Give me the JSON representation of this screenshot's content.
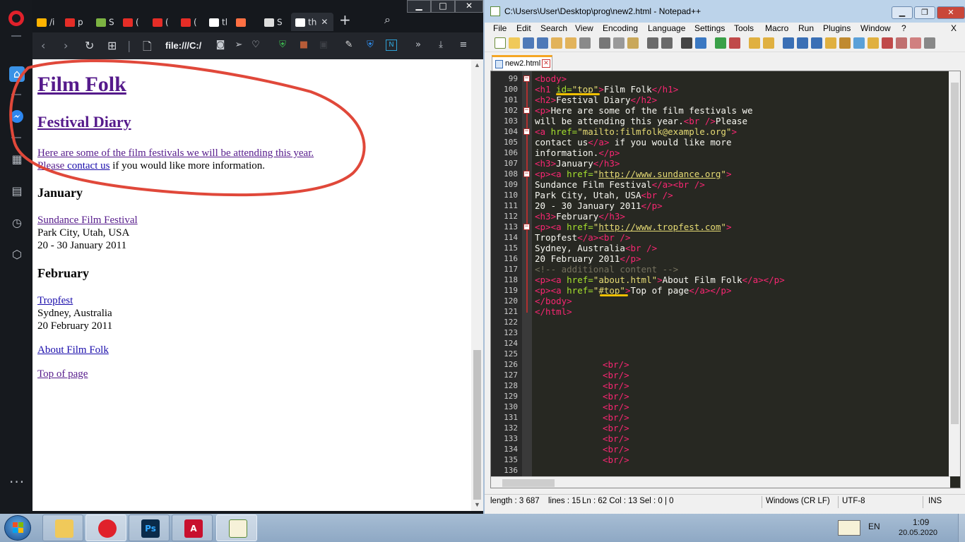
{
  "browser": {
    "tabs": [
      {
        "label": "/i",
        "fav_color": "#ffb300"
      },
      {
        "label": "p",
        "fav_color": "#e52d27"
      },
      {
        "label": "S",
        "fav_color": "#7cb342"
      },
      {
        "label": "(",
        "fav_color": "#e52d27"
      },
      {
        "label": "(",
        "fav_color": "#e52d27"
      },
      {
        "label": "(",
        "fav_color": "#e52d27"
      },
      {
        "label": "tl",
        "fav_color": "#ffffff"
      },
      {
        "label": "",
        "fav_color": "#ff7043"
      },
      {
        "label": "S",
        "fav_color": "#dddddd"
      },
      {
        "label": "th",
        "fav_color": "#ffffff"
      }
    ],
    "address": "file:///C:/",
    "accent": "#e0212b"
  },
  "page": {
    "h1": "Film Folk",
    "h2": "Festival Diary",
    "intro_line1": "Here are some of the film festivals we will be attending this year.",
    "intro_line2_prefix": "Please ",
    "intro_link": "contact us",
    "intro_line2_suffix": " if you would like more information.",
    "jan_heading": "January",
    "jan_link": "Sundance Film Festival",
    "jan_place": "Park City, Utah, USA",
    "jan_dates": "20 - 30 January 2011",
    "feb_heading": "February",
    "feb_link": "Tropfest",
    "feb_place": "Sydney, Australia",
    "feb_dates": "20 February 2011",
    "about_link": "About Film Folk",
    "top_link": "Top of page"
  },
  "npp": {
    "title": "C:\\Users\\User\\Desktop\\prog\\new2.html - Notepad++",
    "menu": [
      "File",
      "Edit",
      "Search",
      "View",
      "Encoding",
      "Language",
      "Settings",
      "Tools",
      "Macro",
      "Run",
      "Plugins",
      "Window",
      "?"
    ],
    "menu_close": "X",
    "tab": "new2.html",
    "line_numbers": [
      "99",
      "100",
      "101",
      "102",
      "103",
      "104",
      "105",
      "106",
      "107",
      "108",
      "109",
      "110",
      "111",
      "112",
      "113",
      "114",
      "115",
      "116",
      "117",
      "118",
      "119",
      "120",
      "121",
      "122",
      "123",
      "124",
      "125",
      "126",
      "127",
      "128",
      "129",
      "130",
      "131",
      "132",
      "133",
      "134",
      "135",
      "136"
    ],
    "br": "<br/>",
    "status": {
      "length": "length : 3 687",
      "lines": "lines : 15",
      "pos": "Ln : 62    Col : 13    Sel : 0 | 0",
      "eol": "Windows (CR LF)",
      "enc": "UTF-8",
      "ins": "INS"
    }
  },
  "taskbar": {
    "lang": "EN",
    "time": "1:09",
    "date": "20.05.2020"
  }
}
